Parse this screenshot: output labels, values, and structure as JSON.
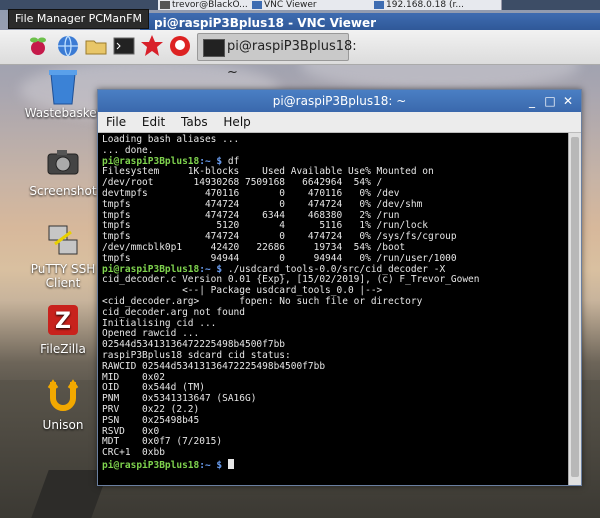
{
  "host_taskbar": {
    "tabs": [
      {
        "label": "trevor@BlackO..."
      },
      {
        "label": "VNC Viewer"
      },
      {
        "label": "192.168.0.18 (r..."
      }
    ]
  },
  "tooltip": "File Manager PCManFM",
  "vnc_window_title": "pi@raspiP3Bplus18 - VNC Viewer",
  "pi_panel": {
    "task_label": "pi@raspiP3Bplus18: ~"
  },
  "desktop_icons": [
    {
      "label": "Wastebasket"
    },
    {
      "label": "Screenshot"
    },
    {
      "label": "PuTTY SSH Client"
    },
    {
      "label": "FileZilla"
    },
    {
      "label": "Unison"
    }
  ],
  "terminal": {
    "title": "pi@raspiP3Bplus18: ~",
    "menu": [
      "File",
      "Edit",
      "Tabs",
      "Help"
    ],
    "prompt_host": "pi@raspiP3Bplus18",
    "prompt_path": ":~ $",
    "lines": [
      {
        "kind": "out",
        "text": "Loading bash aliases ..."
      },
      {
        "kind": "out",
        "text": "... done."
      },
      {
        "kind": "cmd",
        "text": " df"
      },
      {
        "kind": "out",
        "text": "Filesystem     1K-blocks    Used Available Use% Mounted on"
      },
      {
        "kind": "out",
        "text": "/dev/root       14930268 7509168   6642964  54% /"
      },
      {
        "kind": "out",
        "text": "devtmpfs          470116       0    470116   0% /dev"
      },
      {
        "kind": "out",
        "text": "tmpfs             474724       0    474724   0% /dev/shm"
      },
      {
        "kind": "out",
        "text": "tmpfs             474724    6344    468380   2% /run"
      },
      {
        "kind": "out",
        "text": "tmpfs               5120       4      5116   1% /run/lock"
      },
      {
        "kind": "out",
        "text": "tmpfs             474724       0    474724   0% /sys/fs/cgroup"
      },
      {
        "kind": "out",
        "text": "/dev/mmcblk0p1     42420   22686     19734  54% /boot"
      },
      {
        "kind": "out",
        "text": "tmpfs              94944       0     94944   0% /run/user/1000"
      },
      {
        "kind": "cmd",
        "text": " ./usdcard_tools-0.0/src/cid_decoder -X"
      },
      {
        "kind": "out",
        "text": "cid_decoder.c Version 0.01 {Exp}, [15/02/2019], (c) F_Trevor_Gowen"
      },
      {
        "kind": "out",
        "text": "              <--| Package usdcard_tools_0.0 |-->"
      },
      {
        "kind": "out",
        "text": "<cid_decoder.arg>       fopen: No such file or directory"
      },
      {
        "kind": "out",
        "text": "cid_decoder.arg not found"
      },
      {
        "kind": "out",
        "text": "Initialising cid ..."
      },
      {
        "kind": "out",
        "text": "Opened rawcid ..."
      },
      {
        "kind": "out",
        "text": "02544d53413136472225498b4500f7bb"
      },
      {
        "kind": "out",
        "text": "raspiP3Bplus18 sdcard cid status:"
      },
      {
        "kind": "out",
        "text": "RAWCID 02544d53413136472225498b4500f7bb"
      },
      {
        "kind": "out",
        "text": "MID    0x02"
      },
      {
        "kind": "out",
        "text": "OID    0x544d (TM)"
      },
      {
        "kind": "out",
        "text": "PNM    0x5341313647 (SA16G)"
      },
      {
        "kind": "out",
        "text": "PRV    0x22 (2.2)"
      },
      {
        "kind": "out",
        "text": "PSN    0x25498b45"
      },
      {
        "kind": "out",
        "text": "RSVD   0x0"
      },
      {
        "kind": "out",
        "text": "MDT    0x0f7 (7/2015)"
      },
      {
        "kind": "out",
        "text": "CRC+1  0xbb"
      },
      {
        "kind": "cmd",
        "text": " "
      }
    ]
  },
  "colors": {
    "prompt_host": "#7fd34e",
    "prompt_path": "#6a9df0",
    "terminal_bg": "#000000",
    "title_bar": "#3a68ac"
  }
}
